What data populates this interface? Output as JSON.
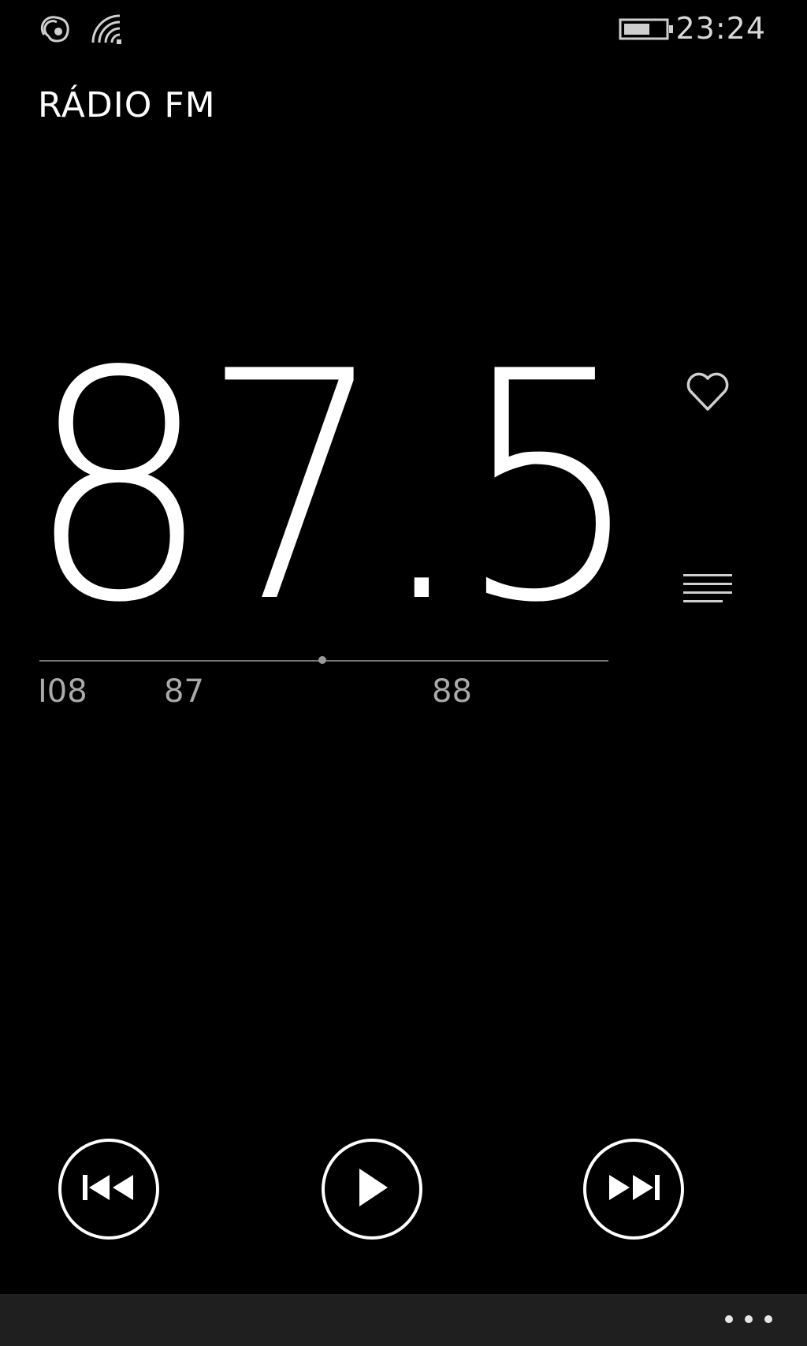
{
  "status": {
    "time": "23:24",
    "icons": [
      "nfc-icon",
      "wifi-icon",
      "battery-icon"
    ]
  },
  "app": {
    "title": "RÁDIO FM"
  },
  "tuner": {
    "frequency": "87.5",
    "scale_labels": [
      "I08",
      "87",
      "88"
    ]
  },
  "actions": {
    "favorite_icon": "heart-icon",
    "stations_icon": "list-icon",
    "previous_icon": "skip-previous-icon",
    "play_icon": "play-icon",
    "next_icon": "skip-next-icon",
    "more_icon": "more-icon"
  },
  "colors": {
    "background": "#000000",
    "foreground": "#ffffff",
    "app_bar": "#1f1f1f"
  }
}
